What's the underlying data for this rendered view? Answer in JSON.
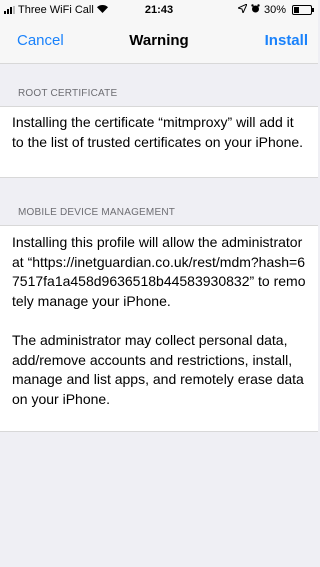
{
  "status_bar": {
    "carrier": "Three WiFi Call",
    "time": "21:43",
    "battery": "30%",
    "battery_level": 0.3
  },
  "nav": {
    "cancel_label": "Cancel",
    "title": "Warning",
    "install_label": "Install",
    "accent_color": "#1a82fb"
  },
  "root_certificate": {
    "header": "ROOT CERTIFICATE",
    "body": "Installing the certificate “mitmproxy” will add it to the list of trusted certificates on your iPhone."
  },
  "mdm": {
    "header": "MOBILE DEVICE MANAGEMENT",
    "body_1": "Installing this profile will allow the administrator at “https://inetguardian.co.uk/rest/mdm?hash=67517fa1a458d9636518b44583930832” to remotely manage your iPhone.",
    "body_2": "The administrator may collect personal data, add/remove accounts and restrictions, install, manage and list apps, and remotely erase data on your iPhone."
  }
}
